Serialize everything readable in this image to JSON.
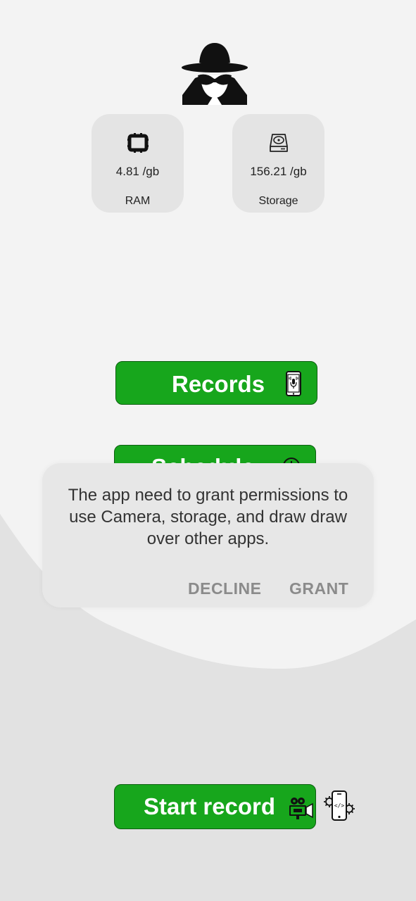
{
  "stats": {
    "ram": {
      "value": "4.81 /gb",
      "label": "RAM",
      "icon": "cpu-chip-icon"
    },
    "storage": {
      "value": "156.21 /gb",
      "label": "Storage",
      "icon": "hard-drive-icon"
    }
  },
  "buttons": {
    "records": {
      "label": "Records",
      "icon": "phone-mic-icon"
    },
    "schedule": {
      "label": "Schedule",
      "icon": "schedule-icon"
    },
    "start_record": {
      "label": "Start record",
      "icon": "video-camera-icon"
    },
    "settings": {
      "icon": "phone-code-settings-icon"
    }
  },
  "dialog": {
    "message": "The app need to grant permissions to use Camera, storage, and draw draw over other apps.",
    "decline_label": "DECLINE",
    "grant_label": "GRANT"
  },
  "logo": {
    "icon": "spy-incognito-icon"
  },
  "colors": {
    "background": "#f3f3f3",
    "wave": "#e2e2e2",
    "card": "#e4e4e4",
    "accent_green": "#17a61c",
    "dialog_bg": "#e7e7e7",
    "dialog_action": "#8b8b8b"
  }
}
